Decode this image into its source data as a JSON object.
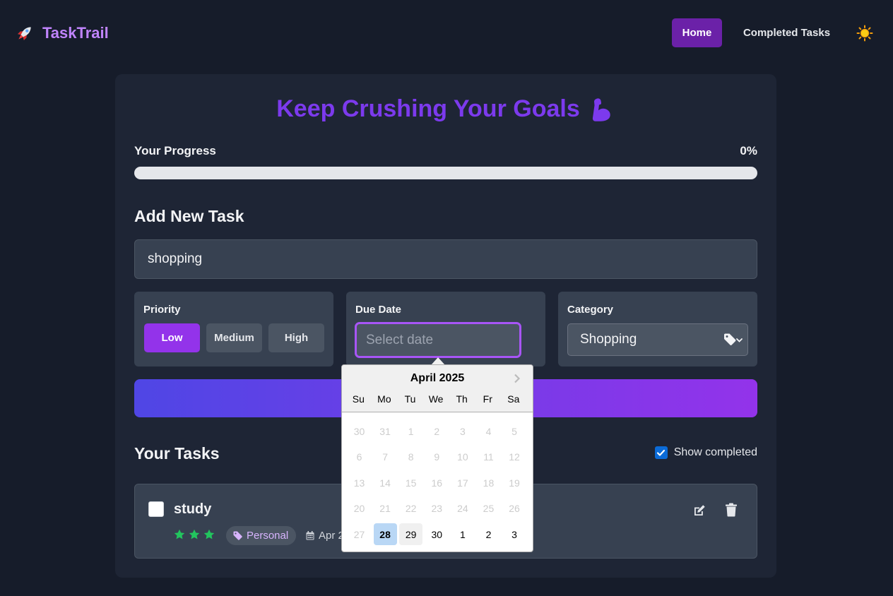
{
  "nav": {
    "brand": "TaskTrail",
    "home": "Home",
    "completed_tasks": "Completed Tasks"
  },
  "main": {
    "headline": "Keep Crushing Your Goals",
    "progress_label": "Your Progress",
    "progress_value": "0%",
    "progress_fraction": 0,
    "add_title": "Add New Task",
    "task_input_value": "shopping",
    "priority": {
      "label": "Priority",
      "options": [
        "Low",
        "Medium",
        "High"
      ],
      "selected": "Low"
    },
    "due_date": {
      "label": "Due Date",
      "placeholder": "Select date"
    },
    "category": {
      "label": "Category",
      "selected": "Shopping"
    },
    "tasks_title": "Your Tasks",
    "show_completed_label": "Show completed",
    "show_completed_checked": true,
    "tasks": [
      {
        "title": "study",
        "stars": 3,
        "category": "Personal",
        "due": "Apr 2",
        "completed": false
      }
    ]
  },
  "datepicker": {
    "month": "April 2025",
    "weekdays": [
      "Su",
      "Mo",
      "Tu",
      "We",
      "Th",
      "Fr",
      "Sa"
    ],
    "weeks": [
      [
        "30",
        "31",
        "1",
        "2",
        "3",
        "4",
        "5"
      ],
      [
        "6",
        "7",
        "8",
        "9",
        "10",
        "11",
        "12"
      ],
      [
        "13",
        "14",
        "15",
        "16",
        "17",
        "18",
        "19"
      ],
      [
        "20",
        "21",
        "22",
        "23",
        "24",
        "25",
        "26"
      ],
      [
        "27",
        "28",
        "29",
        "30",
        "1",
        "2",
        "3"
      ]
    ],
    "today": "28",
    "highlighted": "29"
  },
  "colors": {
    "accent": "#9333ea",
    "brand": "#c084fc",
    "headline": "#7c3aed",
    "star": "#22c55e",
    "background": "#161c2a"
  }
}
